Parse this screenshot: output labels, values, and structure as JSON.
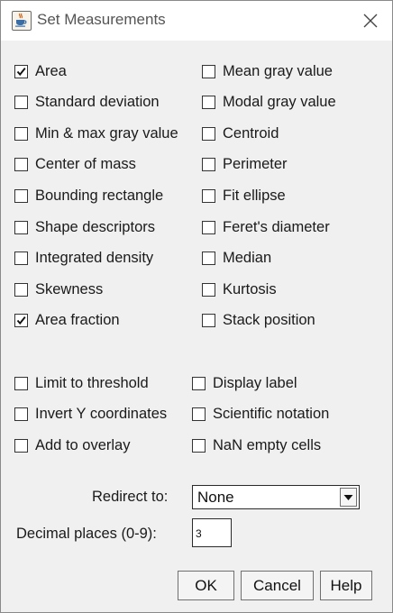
{
  "window": {
    "title": "Set Measurements",
    "app_icon": "java-cup-icon",
    "close_icon": "close-icon"
  },
  "measurements": [
    {
      "label": "Area",
      "checked": true
    },
    {
      "label": "Mean gray value",
      "checked": false
    },
    {
      "label": "Standard deviation",
      "checked": false
    },
    {
      "label": "Modal gray value",
      "checked": false
    },
    {
      "label": "Min & max gray value",
      "checked": false
    },
    {
      "label": "Centroid",
      "checked": false
    },
    {
      "label": "Center of mass",
      "checked": false
    },
    {
      "label": "Perimeter",
      "checked": false
    },
    {
      "label": "Bounding rectangle",
      "checked": false
    },
    {
      "label": "Fit ellipse",
      "checked": false
    },
    {
      "label": "Shape descriptors",
      "checked": false
    },
    {
      "label": "Feret's diameter",
      "checked": false
    },
    {
      "label": "Integrated density",
      "checked": false
    },
    {
      "label": "Median",
      "checked": false
    },
    {
      "label": "Skewness",
      "checked": false
    },
    {
      "label": "Kurtosis",
      "checked": false
    },
    {
      "label": "Area fraction",
      "checked": true
    },
    {
      "label": "Stack position",
      "checked": false
    }
  ],
  "options": [
    {
      "label": "Limit to threshold",
      "checked": false
    },
    {
      "label": "Display label",
      "checked": false
    },
    {
      "label": "Invert Y coordinates",
      "checked": false
    },
    {
      "label": "Scientific notation",
      "checked": false
    },
    {
      "label": "Add to overlay",
      "checked": false
    },
    {
      "label": "NaN empty cells",
      "checked": false
    }
  ],
  "redirect": {
    "label": "Redirect to:",
    "value": "None"
  },
  "decimal": {
    "label": "Decimal places (0-9):",
    "value": "3"
  },
  "buttons": {
    "ok": "OK",
    "cancel": "Cancel",
    "help": "Help"
  }
}
